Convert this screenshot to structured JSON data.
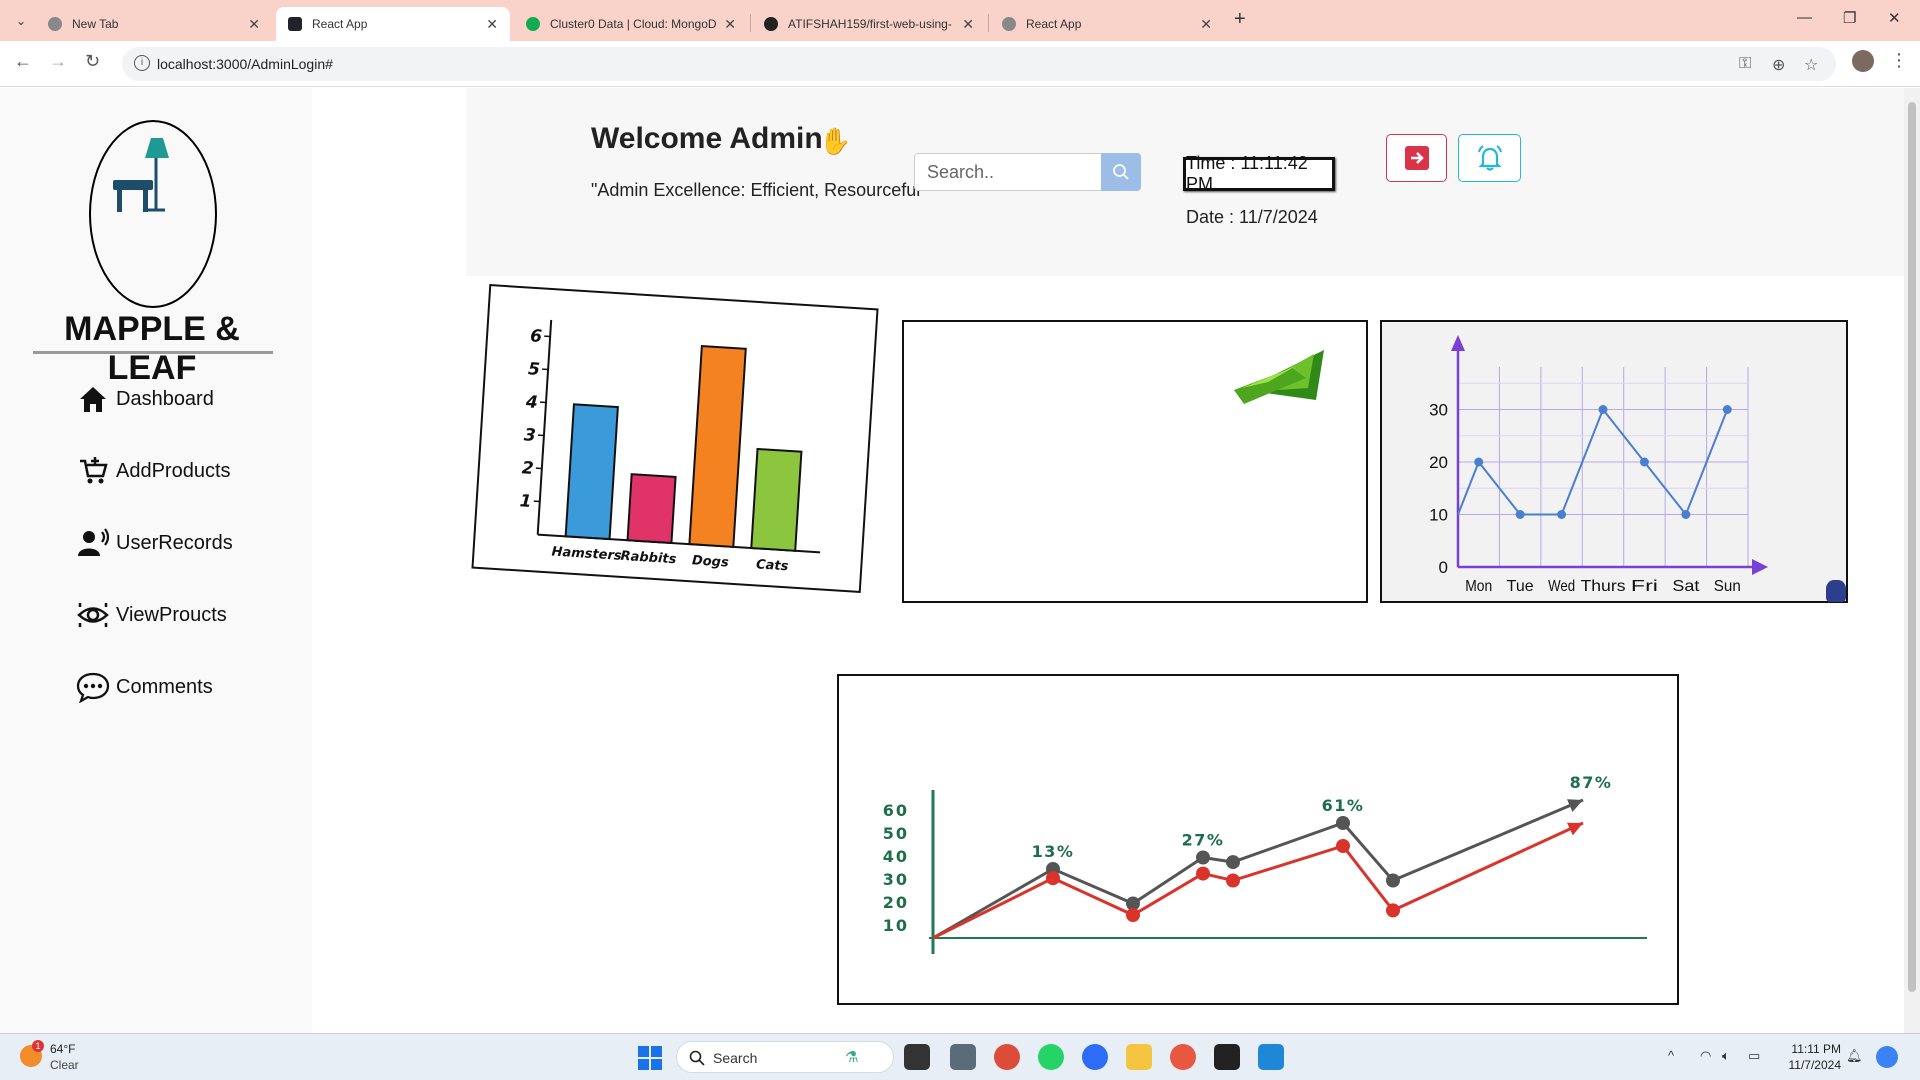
{
  "browser": {
    "tabs": [
      {
        "title": "New Tab",
        "active": false
      },
      {
        "title": "React App",
        "active": true
      },
      {
        "title": "Cluster0 Data | Cloud: MongoD",
        "active": false
      },
      {
        "title": "ATIFSHAH159/first-web-using-",
        "active": false
      },
      {
        "title": "React App",
        "active": false
      }
    ],
    "url": "localhost:3000/AdminLogin#"
  },
  "sidebar": {
    "brand": "MAPPLE & LEAF",
    "items": [
      {
        "label": "Dashboard",
        "icon": "home-icon"
      },
      {
        "label": "AddProducts",
        "icon": "cart-add-icon"
      },
      {
        "label": "UserRecords",
        "icon": "user-voice-icon"
      },
      {
        "label": "ViewProucts",
        "icon": "eye-icon"
      },
      {
        "label": "Comments",
        "icon": "comment-dots-icon"
      }
    ]
  },
  "header": {
    "welcome": "Welcome Admin",
    "tagline": "\"Admin Excellence: Efficient, Resourceful\"",
    "search_placeholder": "Search..",
    "time_label": "Time : 11:11:42 PM",
    "date_label": "Date : 11/7/2024",
    "logout_color": "#d9334a",
    "bell_color": "#22b9d6"
  },
  "chart_data": [
    {
      "type": "bar",
      "categories": [
        "Hamsters",
        "Rabbits",
        "Dogs",
        "Cats"
      ],
      "values": [
        4,
        2,
        6,
        3
      ],
      "colors": [
        "#3b9ad9",
        "#e0336a",
        "#f58220",
        "#8cc63f"
      ],
      "yticks": [
        1,
        2,
        3,
        4,
        5,
        6
      ],
      "ylim": [
        0,
        6.5
      ]
    },
    {
      "type": "line",
      "categories": [
        "Mon",
        "Tue",
        "Wed",
        "Thurs",
        "Fri",
        "Sat",
        "Sun"
      ],
      "values": [
        20,
        10,
        10,
        30,
        20,
        10,
        30
      ],
      "start_value": 10,
      "yticks": [
        0,
        10,
        20,
        30
      ],
      "ylim": [
        0,
        40
      ],
      "grid": true,
      "line_color": "#4a7fd0",
      "axis_color": "#7a3fd4"
    },
    {
      "type": "line",
      "yticks": [
        10,
        20,
        30,
        40,
        50,
        60
      ],
      "ylim": [
        0,
        60
      ],
      "series": [
        {
          "color": "#555555",
          "values": [
            0,
            30,
            15,
            35,
            33,
            50,
            25,
            60
          ]
        },
        {
          "color": "#d9332b",
          "values": [
            0,
            26,
            10,
            28,
            25,
            40,
            12,
            50
          ]
        }
      ],
      "annotations": [
        "13%",
        "27%",
        "61%",
        "87%"
      ]
    }
  ],
  "taskbar": {
    "weather_temp": "64°F",
    "weather_desc": "Clear",
    "weather_badge": "1",
    "search_label": "Search",
    "time": "11:11 PM",
    "date": "11/7/2024"
  }
}
